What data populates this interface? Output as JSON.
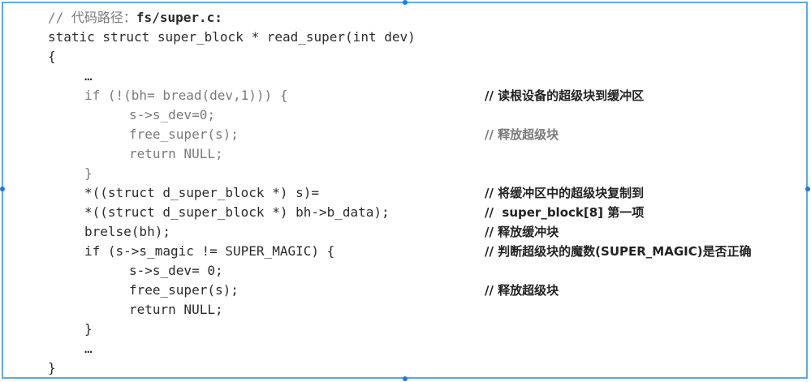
{
  "header": {
    "comment_prefix": "//",
    "comment_label": "代码路径：",
    "path": "fs/super.c:"
  },
  "code": {
    "line1": "static struct super_block * read_super(int dev)",
    "line2": "{",
    "line3": "…",
    "line4": "if (!(bh= bread(dev,1))) {",
    "line5": "s->s_dev=0;",
    "line6": "free_super(s);",
    "line7": "return NULL;",
    "line8": "}",
    "line9": "*((struct d_super_block *) s)=",
    "line10": "*((struct d_super_block *) bh->b_data);",
    "line11": "brelse(bh);",
    "line12": "if (s->s_magic != SUPER_MAGIC) {",
    "line13": "s->s_dev= 0;",
    "line14": "free_super(s);",
    "line15": "return NULL;",
    "line16": "}",
    "line17": "…",
    "line18": "}"
  },
  "comments": {
    "c4": "// 读根设备的超级块到缓冲区",
    "c6": "// 释放超级块",
    "c9": "// 将缓冲区中的超级块复制到",
    "c10": "//  super_block[8] 第一项",
    "c11": "// 释放缓冲块",
    "c12": "// 判断超级块的魔数(SUPER_MAGIC)是否正确",
    "c14": "// 释放超级块"
  },
  "colors": {
    "border": "#5aa9e6",
    "handle": "#1f7ae0",
    "text": "#2b2b2b"
  }
}
